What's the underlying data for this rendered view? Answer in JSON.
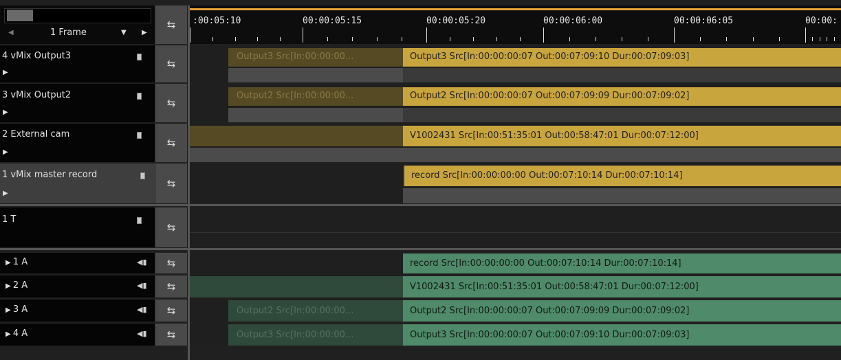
{
  "header": {
    "frame_label": "1 Frame",
    "dropdown_arrow": "▼",
    "left_arrow": "◀",
    "right_arrow": "▶"
  },
  "sync_icon": "⇆",
  "ruler": {
    "timecodes": [
      ":00:05:10",
      "00:00:05:15",
      "00:00:05:20",
      "00:00:06:00",
      "00:00:06:05",
      "00:00:"
    ]
  },
  "tracks": {
    "v4": {
      "name": "4 vMix Output3",
      "clip_dim": "Output3  Src[In:00:00:00...",
      "clip": "Output3  Src[In:00:00:00:07 Out:00:07:09:10 Dur:00:07:09:03]"
    },
    "v3": {
      "name": "3 vMix Output2",
      "clip_dim": "Output2  Src[In:00:00:00...",
      "clip": "Output2  Src[In:00:00:00:07 Out:00:07:09:09 Dur:00:07:09:02]"
    },
    "v2": {
      "name": "2 External cam",
      "clip": "V1002431  Src[In:00:51:35:01 Out:00:58:47:01 Dur:00:07:12:00]"
    },
    "v1": {
      "name": "1 vMix master record",
      "clip": "record  Src[In:00:00:00:00 Out:00:07:10:14 Dur:00:07:10:14]"
    },
    "t1": {
      "name": "1 T"
    },
    "a1": {
      "name": "1 A",
      "clip": "record  Src[In:00:00:00:00 Out:00:07:10:14 Dur:00:07:10:14]"
    },
    "a2": {
      "name": "2 A",
      "clip": "V1002431  Src[In:00:51:35:01 Out:00:58:47:01 Dur:00:07:12:00]"
    },
    "a3": {
      "name": "3 A",
      "clip_dim": "Output2  Src[In:00:00:00...",
      "clip": "Output2  Src[In:00:00:00:07 Out:00:07:09:09 Dur:00:07:09:02]"
    },
    "a4": {
      "name": "4 A",
      "clip_dim": "Output3  Src[In:00:00:00...",
      "clip": "Output3  Src[In:00:00:00:07 Out:00:07:09:10 Dur:00:07:09:03]"
    }
  },
  "colors": {
    "video_clip": "#c9a53e",
    "audio_clip": "#4f8a6a",
    "playhead": "#e8a33a"
  }
}
